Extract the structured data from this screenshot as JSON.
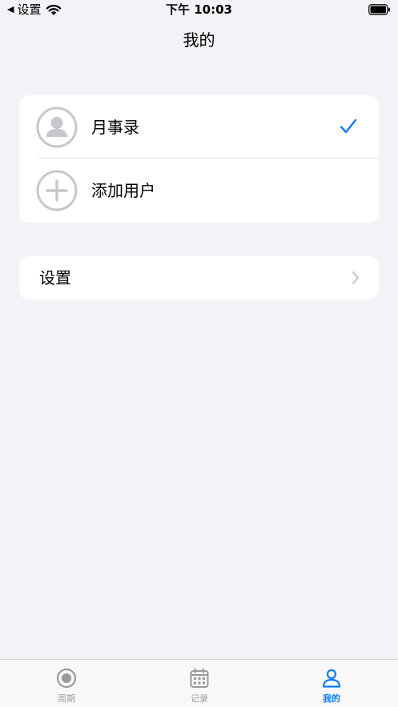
{
  "status_bar": {
    "back_label": "设置",
    "time": "下午 10:03"
  },
  "nav": {
    "title": "我的"
  },
  "users": {
    "items": [
      {
        "label": "月事录",
        "icon": "person-avatar-icon",
        "selected": true
      },
      {
        "label": "添加用户",
        "icon": "plus-circle-icon",
        "selected": false
      }
    ]
  },
  "settings": {
    "label": "设置"
  },
  "tabs": [
    {
      "label": "周期",
      "icon": "cycle-icon",
      "active": false
    },
    {
      "label": "记录",
      "icon": "calendar-icon",
      "active": false
    },
    {
      "label": "我的",
      "icon": "person-icon",
      "active": true
    }
  ],
  "colors": {
    "background": "#F2F2F7",
    "card": "#FFFFFF",
    "accent": "#0A7AFF",
    "inactive": "#9A9A9E",
    "avatar_gray": "#C7C7CC"
  }
}
